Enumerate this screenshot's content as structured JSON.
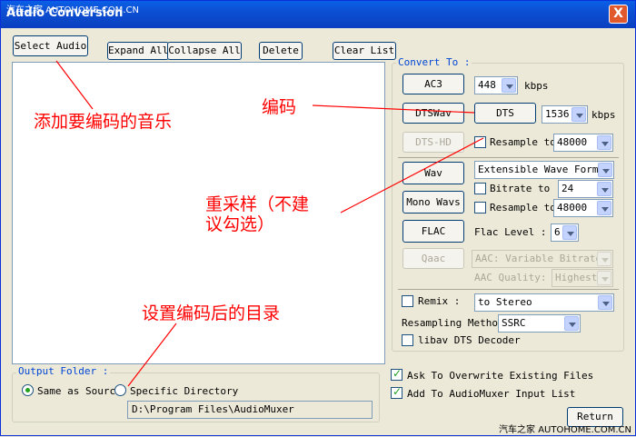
{
  "window": {
    "title": "Audio Conversion",
    "watermark_top": "汽车之家 AUTOHOME.COM.CN",
    "close_label": "X"
  },
  "toolbar": {
    "select_audio": "Select Audio",
    "expand_all": "Expand All",
    "collapse_all": "Collapse All",
    "delete": "Delete",
    "clear_list": "Clear List"
  },
  "convert_to": {
    "group_label": "Convert To :",
    "ac3_button": "AC3",
    "ac3_bitrate": "448",
    "kbps_1": "kbps",
    "dtswav_button": "DTSWav",
    "dts_button": "DTS",
    "dts_bitrate": "1536",
    "kbps_2": "kbps",
    "dtshd_button": "DTS-HD",
    "resample_label_1": "Resample to",
    "resample_value_1": "48000",
    "wav_button": "Wav",
    "wav_format": "Extensible Wave Format",
    "bitrate_label": "Bitrate to :",
    "bitrate_value": "24",
    "mono_wavs_button": "Mono Wavs",
    "resample_label_2": "Resample to",
    "resample_value_2": "48000",
    "flac_button": "FLAC",
    "flac_level_label": "Flac Level :",
    "flac_level_value": "6",
    "qaac_button": "Qaac",
    "aac_mode": "AAC: Variable Bitrate",
    "aac_quality_label": "AAC Quality:",
    "aac_quality_value": "Highest",
    "remix_label": "Remix :",
    "remix_value": "to Stereo",
    "resampling_method_label": "Resampling Method",
    "resampling_method_value": "SSRC",
    "libav_label": "libav DTS Decoder"
  },
  "output": {
    "group_label": "Output Folder :",
    "same_as_source": "Same as Source",
    "specific_directory": "Specific Directory",
    "path": "D:\\Program Files\\AudioMuxer"
  },
  "options": {
    "ask_overwrite": "Ask To Overwrite Existing Files",
    "add_to_input": "Add To AudioMuxer Input List"
  },
  "return_button": "Return",
  "annotations": {
    "add_music": "添加要编码的音乐",
    "encode": "编码",
    "resample_line1": "重采样（不建",
    "resample_line2": "议勾选）",
    "output_dir": "设置编码后的目录"
  },
  "watermark_bottom": "汽车之家 AUTOHOME.COM.CN",
  "colors": {
    "title_bar": "#0c4fd3",
    "annotation": "#ff0000",
    "group_label": "#0046d5",
    "check": "#21a121"
  }
}
